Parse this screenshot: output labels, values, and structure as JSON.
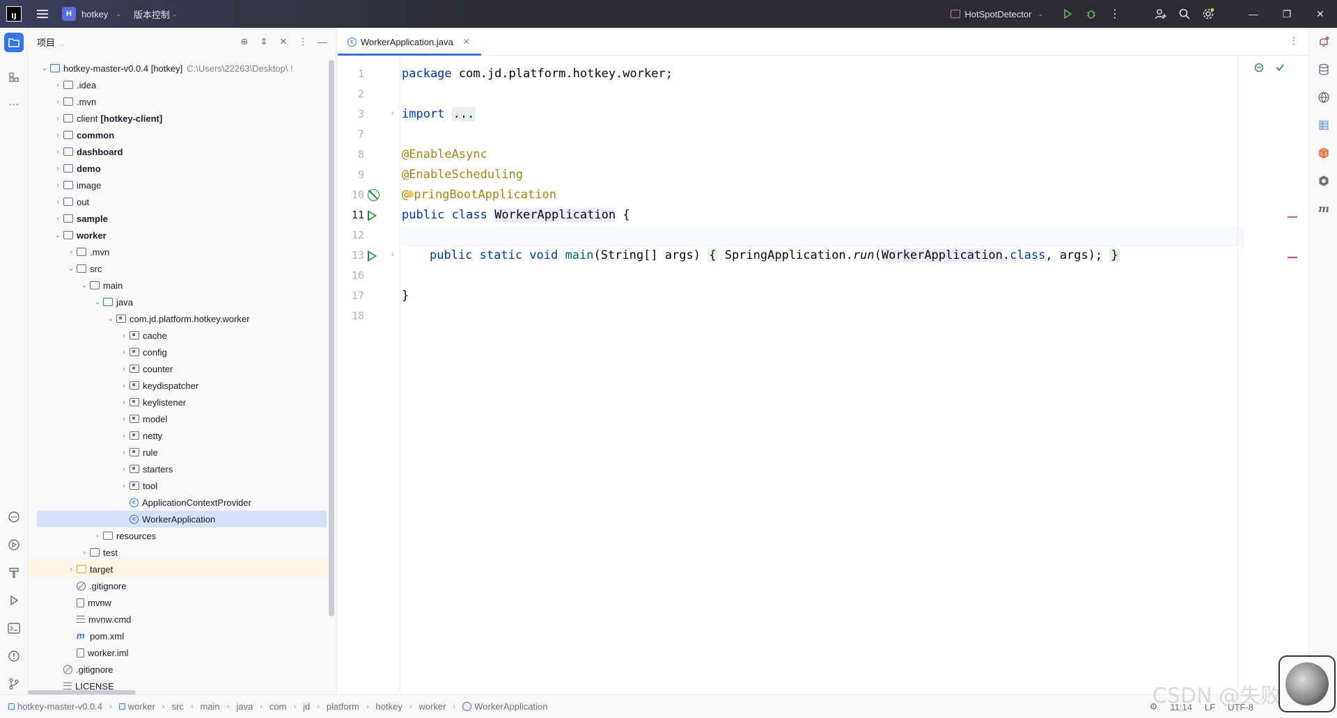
{
  "titlebar": {
    "project_badge": "H",
    "project_name": "hotkey",
    "vcs_label": "版本控制",
    "run_config": "HotSpotDetector"
  },
  "project_panel": {
    "title": "项目",
    "tree": [
      {
        "indent": 0,
        "arrow": "v",
        "icon": "module",
        "label": "hotkey-master-v0.0.4 [hotkey]",
        "hint": "C:\\Users\\22263\\Desktop\\ !",
        "bold": false
      },
      {
        "indent": 1,
        "arrow": ">",
        "icon": "folder",
        "label": ".idea",
        "bold": false
      },
      {
        "indent": 1,
        "arrow": ">",
        "icon": "folder",
        "label": ".mvn",
        "bold": false
      },
      {
        "indent": 1,
        "arrow": ">",
        "icon": "folder",
        "label": "client",
        "label_suffix": "[hotkey-client]",
        "bold": false
      },
      {
        "indent": 1,
        "arrow": ">",
        "icon": "folder",
        "label": "common",
        "bold": true
      },
      {
        "indent": 1,
        "arrow": ">",
        "icon": "folder",
        "label": "dashboard",
        "bold": true
      },
      {
        "indent": 1,
        "arrow": ">",
        "icon": "folder",
        "label": "demo",
        "bold": true
      },
      {
        "indent": 1,
        "arrow": ">",
        "icon": "folder",
        "label": "image",
        "bold": false
      },
      {
        "indent": 1,
        "arrow": ">",
        "icon": "folder",
        "label": "out",
        "bold": false
      },
      {
        "indent": 1,
        "arrow": ">",
        "icon": "folder",
        "label": "sample",
        "bold": true
      },
      {
        "indent": 1,
        "arrow": "v",
        "icon": "folder",
        "label": "worker",
        "bold": true
      },
      {
        "indent": 2,
        "arrow": ">",
        "icon": "folder",
        "label": ".mvn",
        "bold": false
      },
      {
        "indent": 2,
        "arrow": "v",
        "icon": "folder",
        "label": "src",
        "bold": false
      },
      {
        "indent": 3,
        "arrow": "v",
        "icon": "folder",
        "label": "main",
        "bold": false
      },
      {
        "indent": 4,
        "arrow": "v",
        "icon": "folder-src",
        "label": "java",
        "bold": false
      },
      {
        "indent": 5,
        "arrow": "v",
        "icon": "package",
        "label": "com.jd.platform.hotkey.worker",
        "bold": false
      },
      {
        "indent": 6,
        "arrow": ">",
        "icon": "package",
        "label": "cache",
        "bold": false
      },
      {
        "indent": 6,
        "arrow": ">",
        "icon": "package",
        "label": "config",
        "bold": false
      },
      {
        "indent": 6,
        "arrow": ">",
        "icon": "package",
        "label": "counter",
        "bold": false
      },
      {
        "indent": 6,
        "arrow": ">",
        "icon": "package",
        "label": "keydispatcher",
        "bold": false
      },
      {
        "indent": 6,
        "arrow": ">",
        "icon": "package",
        "label": "keylistener",
        "bold": false
      },
      {
        "indent": 6,
        "arrow": ">",
        "icon": "package",
        "label": "model",
        "bold": false
      },
      {
        "indent": 6,
        "arrow": ">",
        "icon": "package",
        "label": "netty",
        "bold": false
      },
      {
        "indent": 6,
        "arrow": ">",
        "icon": "package",
        "label": "rule",
        "bold": false
      },
      {
        "indent": 6,
        "arrow": ">",
        "icon": "package",
        "label": "starters",
        "bold": false
      },
      {
        "indent": 6,
        "arrow": ">",
        "icon": "package",
        "label": "tool",
        "bold": false
      },
      {
        "indent": 6,
        "arrow": "",
        "icon": "class",
        "label": "ApplicationContextProvider",
        "bold": false
      },
      {
        "indent": 6,
        "arrow": "",
        "icon": "class-run",
        "label": "WorkerApplication",
        "bold": false,
        "selected": true
      },
      {
        "indent": 4,
        "arrow": ">",
        "icon": "folder-res",
        "label": "resources",
        "bold": false
      },
      {
        "indent": 3,
        "arrow": ">",
        "icon": "folder",
        "label": "test",
        "bold": false
      },
      {
        "indent": 2,
        "arrow": ">",
        "icon": "folder-orange",
        "label": "target",
        "bold": false,
        "target": true
      },
      {
        "indent": 2,
        "arrow": "",
        "icon": "ignore",
        "label": ".gitignore",
        "bold": false
      },
      {
        "indent": 2,
        "arrow": "",
        "icon": "file",
        "label": "mvnw",
        "bold": false
      },
      {
        "indent": 2,
        "arrow": "",
        "icon": "lines",
        "label": "mvnw.cmd",
        "bold": false
      },
      {
        "indent": 2,
        "arrow": "",
        "icon": "maven",
        "label": "pom.xml",
        "bold": false
      },
      {
        "indent": 2,
        "arrow": "",
        "icon": "file",
        "label": "worker.iml",
        "bold": false
      },
      {
        "indent": 1,
        "arrow": "",
        "icon": "ignore",
        "label": ".gitignore",
        "bold": false
      },
      {
        "indent": 1,
        "arrow": "",
        "icon": "lines",
        "label": "LICENSE",
        "bold": false
      }
    ]
  },
  "editor": {
    "tab_label": "WorkerApplication.java",
    "code": {
      "l1_kw": "package",
      "l1_rest": " com.jd.platform.hotkey.worker;",
      "l3_kw": "import",
      "l3_fold": "...",
      "l8": "@EnableAsync",
      "l9": "@EnableScheduling",
      "l10_a": "@",
      "l10_b": "pringBootApplication",
      "l11_kw": "public class",
      "l11_name": "WorkerApplication",
      "l11_rest": " {",
      "l13_kw": "public static void",
      "l13_fn": "main",
      "l13_args": "(String[] args)",
      "l13_ob": "{",
      "l13_call": " SpringApplication.",
      "l13_run": "run",
      "l13_p1": "(",
      "l13_ref": "WorkerApplication",
      "l13_dot": ".",
      "l13_class": "class",
      "l13_p2": ", args);",
      "l13_cb": "}",
      "l17": "}"
    },
    "line_numbers": [
      "1",
      "2",
      "3",
      "7",
      "8",
      "9",
      "10",
      "11",
      "12",
      "13",
      "16",
      "17",
      "18"
    ]
  },
  "statusbar": {
    "breadcrumbs": [
      "hotkey-master-v0.0.4",
      "worker",
      "src",
      "main",
      "java",
      "com",
      "jd",
      "platform",
      "hotkey",
      "worker",
      "WorkerApplication"
    ],
    "time": "11:14",
    "line_sep": "LF",
    "encoding": "UTF-8"
  },
  "watermark": "CSDN @失败13",
  "colors": {
    "accent": "#3574f0",
    "keyword": "#0033b3",
    "annotation": "#9e880d",
    "run_green": "#208a3c"
  }
}
